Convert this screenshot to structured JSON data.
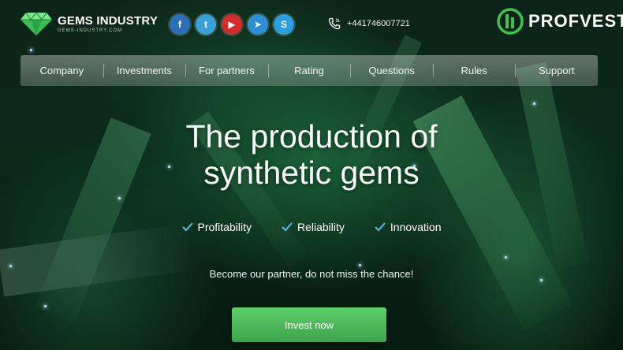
{
  "brand": {
    "name": "GEMS INDUSTRY",
    "url": "GEMS-INDUSTRY.COM",
    "accent": "#4fd16a"
  },
  "socials": [
    {
      "label": "f",
      "icon": "facebook-icon",
      "color": "#2d6fb6"
    },
    {
      "label": "t",
      "icon": "twitter-icon",
      "color": "#3aa0d8"
    },
    {
      "label": "▶",
      "icon": "youtube-icon",
      "color": "#d52b2b"
    },
    {
      "label": "➤",
      "icon": "telegram-icon",
      "color": "#2b8fd1"
    },
    {
      "label": "S",
      "icon": "skype-icon",
      "color": "#2a9ee0"
    }
  ],
  "phone": "+441746007721",
  "watermark": "PROFVEST",
  "nav": [
    "Company",
    "Investments",
    "For partners",
    "Rating",
    "Questions",
    "Rules",
    "Support"
  ],
  "hero": {
    "title_line1": "The production of",
    "title_line2": "synthetic gems",
    "features": [
      "Profitability",
      "Reliability",
      "Innovation"
    ],
    "tagline": "Become our partner, do not miss the chance!",
    "cta": "Invest now"
  }
}
